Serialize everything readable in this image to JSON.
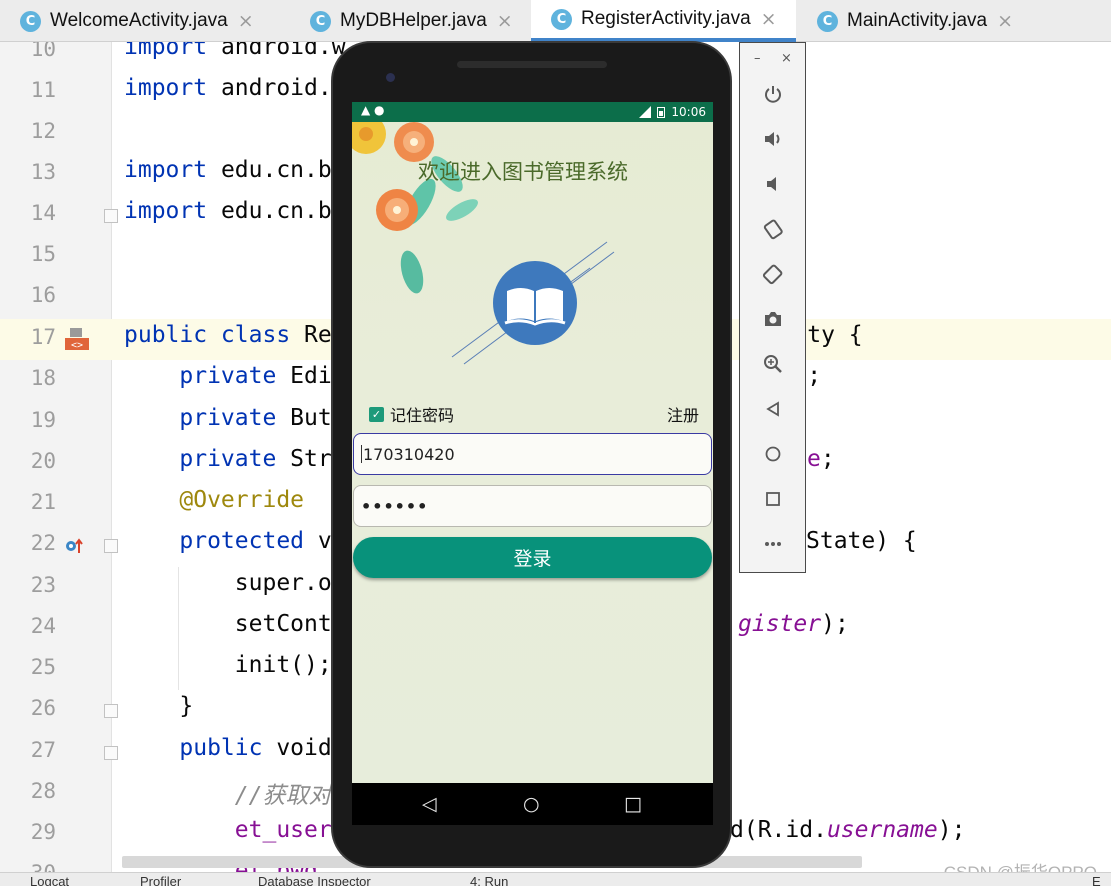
{
  "tabs": [
    {
      "label": "WelcomeActivity.java",
      "icon": "C",
      "active": false
    },
    {
      "label": "MyDBHelper.java",
      "icon": "C",
      "active": false
    },
    {
      "label": "RegisterActivity.java",
      "icon": "C",
      "active": true
    },
    {
      "label": "MainActivity.java",
      "icon": "C",
      "active": false
    }
  ],
  "close_glyph": "×",
  "editor": {
    "line_numbers": [
      "10",
      "11",
      "12",
      "13",
      "14",
      "15",
      "16",
      "17",
      "18",
      "19",
      "20",
      "21",
      "22",
      "23",
      "24",
      "25",
      "26",
      "27",
      "28",
      "29",
      "30"
    ],
    "lines": [
      {
        "kw": "import ",
        "text": "android.w"
      },
      {
        "kw": "import ",
        "text": "android."
      },
      {
        "kw": "",
        "text": ""
      },
      {
        "kw": "import ",
        "text": "edu.cn.b"
      },
      {
        "kw": "import ",
        "text": "edu.cn.b"
      },
      {
        "kw": "",
        "text": ""
      },
      {
        "kw": "",
        "text": ""
      },
      {
        "kw": "public class ",
        "text": "Re",
        "right": "ctivity {"
      },
      {
        "kw": "    private ",
        "text": "Edi",
        "right": "re;",
        "right_fld": "ure"
      },
      {
        "kw": "    private ",
        "text": "But"
      },
      {
        "kw": "    private ",
        "text": "Str",
        "right": ";",
        "right_fld": "e"
      },
      {
        "an": "    @Override",
        "text": ""
      },
      {
        "kw": "    protected ",
        "text": "v",
        "right": "State) {"
      },
      {
        "kw": "",
        "text": "        super.o"
      },
      {
        "kw": "",
        "text": "        setCont",
        "right": ");",
        "right_fld": "gister"
      },
      {
        "kw": "",
        "text": "        init();"
      },
      {
        "kw": "",
        "text": "    }"
      },
      {
        "kw": "    public ",
        "text": "void"
      },
      {
        "cm": "        //获取对",
        "text": ""
      },
      {
        "kw": "",
        "text": "        et_user",
        "right": "d(R.id.",
        "right_fld": "username",
        "right_end": ");"
      },
      {
        "kw": "",
        "text": "        et_pwd"
      }
    ]
  },
  "phone": {
    "status_time": "10:06",
    "status_left": "▲ ●",
    "app_title": "欢迎进入图书管理系统",
    "remember_label": "记住密码",
    "remember_checked": true,
    "register_link": "注册",
    "username_value": "170310420",
    "password_mask": "••••••",
    "login_label": "登录",
    "nav_back": "◁",
    "nav_home": "○",
    "nav_recent": "□"
  },
  "emulator_toolbar": {
    "minimize": "–",
    "close": "×",
    "buttons": [
      "power-icon",
      "volume-up-icon",
      "volume-down-icon",
      "rotate-left-icon",
      "rotate-right-icon",
      "camera-icon",
      "zoom-icon",
      "back-icon",
      "home-icon",
      "overview-icon",
      "more-icon"
    ]
  },
  "status_bar": {
    "items": [
      "Logcat",
      "Profiler",
      "Database Inspector",
      "4: Run"
    ],
    "right": "E"
  },
  "watermark": "CSDN @振华OPPO",
  "colors": {
    "accent": "#4083c9",
    "app_status_bar": "#0c6e4a",
    "login_button": "#08927b",
    "logo_blue": "#3e79bd",
    "keyword": "#0033b3",
    "annotation": "#9e880d",
    "field": "#871094"
  }
}
